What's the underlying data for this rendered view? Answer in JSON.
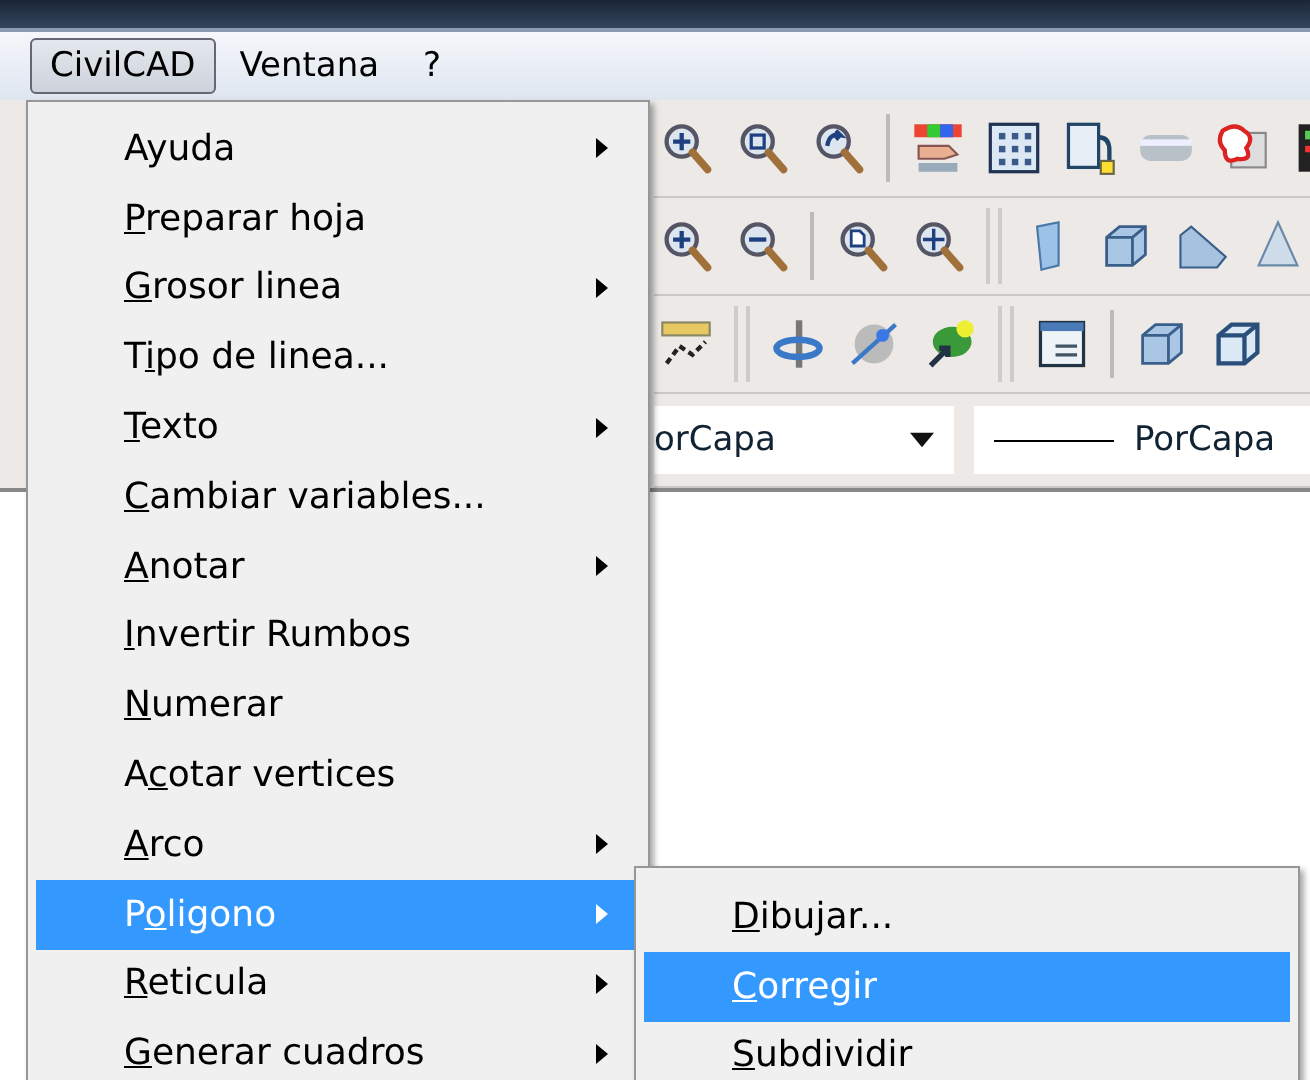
{
  "menubar": [
    {
      "label": "CivilCAD",
      "selected": true
    },
    {
      "label": "Ventana",
      "selected": false
    },
    {
      "label": "?",
      "selected": false
    }
  ],
  "combos": [
    {
      "kind": "dropdown",
      "value": "orCapa"
    },
    {
      "kind": "linetype",
      "value": "PorCapa"
    }
  ],
  "menu": {
    "items": [
      {
        "pre": "Ayuda",
        "submenu": true,
        "selected": false
      },
      {
        "key": "P",
        "post": "reparar hoja",
        "submenu": false,
        "selected": false
      },
      {
        "key": "G",
        "post": "rosor linea",
        "submenu": true,
        "selected": false
      },
      {
        "pre": "T",
        "key": "i",
        "post": "po de linea...",
        "submenu": false,
        "selected": false
      },
      {
        "key": "T",
        "post": "exto",
        "submenu": true,
        "selected": false
      },
      {
        "key": "C",
        "post": "ambiar variables...",
        "submenu": false,
        "selected": false
      },
      {
        "key": "A",
        "post": "notar",
        "submenu": true,
        "selected": false
      },
      {
        "key": "I",
        "post": "nvertir Rumbos",
        "submenu": false,
        "selected": false
      },
      {
        "key": "N",
        "post": "umerar",
        "submenu": false,
        "selected": false
      },
      {
        "pre": "A",
        "key": "c",
        "post": "otar vertices",
        "submenu": false,
        "selected": false
      },
      {
        "key": "A",
        "post": "rco",
        "submenu": true,
        "selected": false
      },
      {
        "pre": "P",
        "key": "o",
        "post": "ligono",
        "submenu": true,
        "selected": true
      },
      {
        "key": "R",
        "post": "eticula",
        "submenu": true,
        "selected": false
      },
      {
        "key": "G",
        "post": "enerar cuadros",
        "submenu": true,
        "selected": false
      }
    ]
  },
  "submenu": {
    "items": [
      {
        "key": "D",
        "post": "ibujar...",
        "selected": false
      },
      {
        "key": "C",
        "post": "orregir",
        "selected": true
      },
      {
        "key": "S",
        "post": "ubdividir",
        "selected": false
      }
    ]
  }
}
